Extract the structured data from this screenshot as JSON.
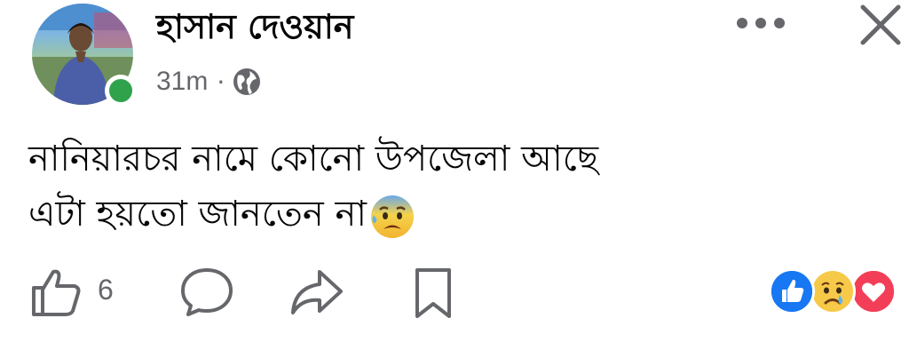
{
  "post": {
    "author": "হাসান দেওয়ান",
    "time": "31m",
    "separator": "·",
    "privacy_icon": "globe-icon",
    "text_lines": [
      "নানিয়ারচর নামে কোনো উপজেলা আছে",
      "এটা হয়তো জানতেন না"
    ],
    "text_emoji": "anxious-sweat-face-emoji"
  },
  "actions": {
    "like_count": "6",
    "like_icon": "thumbs-up-outline-icon",
    "comment_icon": "comment-bubble-icon",
    "share_icon": "share-arrow-icon",
    "save_icon": "bookmark-icon"
  },
  "reactions": [
    "like-reaction-icon",
    "sad-reaction-icon",
    "love-reaction-icon"
  ],
  "header_buttons": [
    "more-options-icon",
    "close-icon"
  ],
  "colors": {
    "online": "#31a24c",
    "secondary_text": "#65676b",
    "like_blue": "#1877f2",
    "love_red": "#f33e58"
  }
}
